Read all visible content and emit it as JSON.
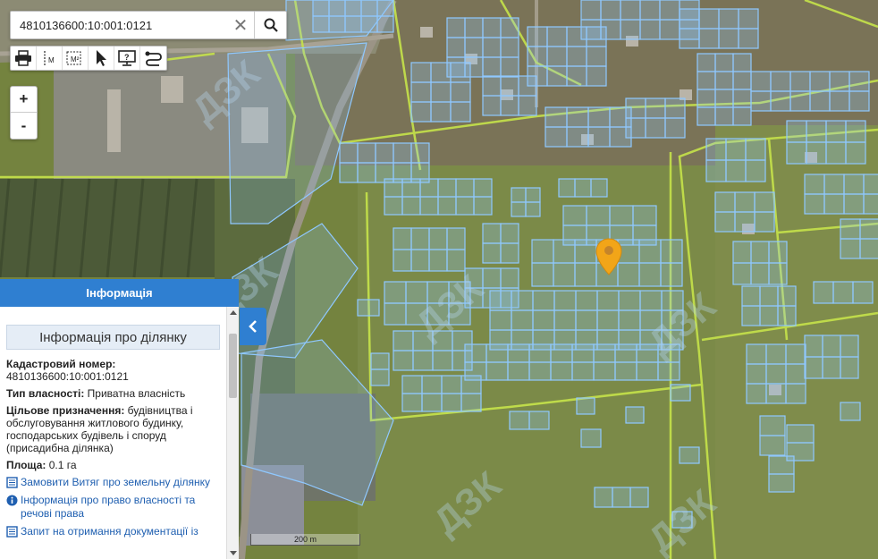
{
  "search": {
    "value": "4810136600:10:001:0121",
    "placeholder": ""
  },
  "toolbar": {
    "tools": [
      "print-icon",
      "measure-distance-icon",
      "measure-area-icon",
      "pointer-icon",
      "info-icon",
      "route-icon"
    ],
    "measure_line_label": "M",
    "measure_area_label": "M²",
    "info_label": "?"
  },
  "zoom": {
    "in_label": "+",
    "out_label": "-"
  },
  "panel": {
    "header": "Інформація",
    "section_title": "Інформація про ділянку",
    "cadastral_label": "Кадастровий номер:",
    "cadastral_value": "4810136600:10:001:0121",
    "ownership_label": "Тип власності:",
    "ownership_value": " Приватна власність",
    "purpose_label": "Цільове призначення:",
    "purpose_value": " будівництва і обслуговування житлового будинку, господарських будівель і споруд (присадибна ділянка)",
    "area_label": "Площа:",
    "area_value": " 0.1 га",
    "links": [
      "Замовити Витяг про земельну ділянку",
      "Інформація про право власності та речові права",
      "Запит на отримання документації із"
    ]
  },
  "map": {
    "scale_label": "200 m",
    "watermark": "ДЗК",
    "marker_color": "#f2a518",
    "parcel_stroke": "#8fc8ff",
    "boundary_stroke": "#c6e34a"
  }
}
